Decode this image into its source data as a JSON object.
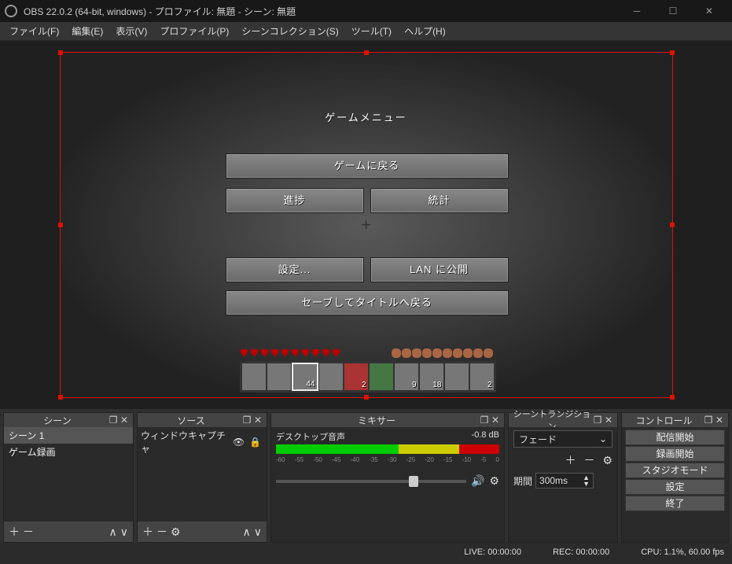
{
  "title": "OBS 22.0.2 (64-bit, windows) - プロファイル: 無題 - シーン: 無題",
  "menu": [
    "ファイル(F)",
    "編集(E)",
    "表示(V)",
    "プロファイル(P)",
    "シーンコレクション(S)",
    "ツール(T)",
    "ヘルプ(H)"
  ],
  "game": {
    "menu_title": "ゲームメニュー",
    "return": "ゲームに戻る",
    "progress": "進捗",
    "stats": "統計",
    "settings": "設定...",
    "lan": "LAN に公開",
    "save_quit": "セーブしてタイトルへ戻る",
    "hotbar_counts": [
      "",
      "",
      "44",
      "",
      "2",
      "",
      "9",
      "18",
      "",
      "2"
    ]
  },
  "docks": {
    "scenes": {
      "title": "シーン",
      "items": [
        "シーン 1",
        "ゲーム録画"
      ],
      "selected": 0
    },
    "sources": {
      "title": "ソース",
      "items": [
        {
          "name": "ウィンドウキャプチャ",
          "visible": true,
          "locked": true
        }
      ]
    },
    "mixer": {
      "title": "ミキサー",
      "channel": "デスクトップ音声",
      "db": "-0.8 dB",
      "ticks": [
        "-60",
        "-55",
        "-50",
        "-45",
        "-40",
        "-35",
        "-30",
        "-25",
        "-20",
        "-15",
        "-10",
        "-5",
        "0"
      ]
    },
    "transition": {
      "title": "シーントランジション",
      "type": "フェード",
      "duration_label": "期間",
      "duration": "300ms"
    },
    "controls": {
      "title": "コントロール",
      "buttons": [
        "配信開始",
        "録画開始",
        "スタジオモード",
        "設定",
        "終了"
      ]
    }
  },
  "status": {
    "live": "LIVE: 00:00:00",
    "rec": "REC: 00:00:00",
    "cpu": "CPU: 1.1%, 60.00 fps"
  }
}
